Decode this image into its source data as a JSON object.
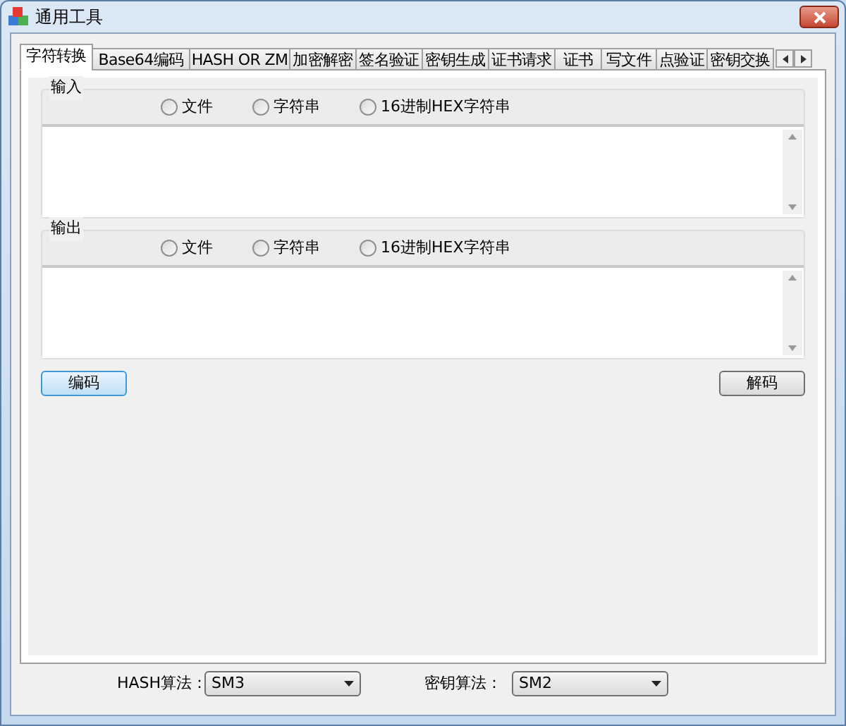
{
  "window": {
    "title": "通用工具"
  },
  "tabs": [
    {
      "label": "字符转换",
      "selected": true
    },
    {
      "label": "Base64编码",
      "selected": false
    },
    {
      "label": "HASH OR ZM",
      "selected": false
    },
    {
      "label": "加密解密",
      "selected": false
    },
    {
      "label": "签名验证",
      "selected": false
    },
    {
      "label": "密钥生成",
      "selected": false
    },
    {
      "label": "证书请求",
      "selected": false
    },
    {
      "label": "证书",
      "selected": false
    },
    {
      "label": "写文件",
      "selected": false
    },
    {
      "label": "点验证",
      "selected": false
    },
    {
      "label": "密钥交换",
      "selected": false
    }
  ],
  "groups": [
    {
      "title": "输入",
      "options": [
        {
          "label": "文件",
          "selected": false
        },
        {
          "label": "字符串",
          "selected": false
        },
        {
          "label": "16进制HEX字符串",
          "selected": false
        }
      ]
    },
    {
      "title": "输出",
      "options": [
        {
          "label": "文件",
          "selected": false
        },
        {
          "label": "字符串",
          "selected": false
        },
        {
          "label": "16进制HEX字符串",
          "selected": false
        }
      ]
    }
  ],
  "buttons": [
    {
      "label": "编码",
      "default": true
    },
    {
      "label": "解码",
      "default": false
    }
  ],
  "settings": [
    {
      "label": "HASH算法：",
      "value": "SM3"
    },
    {
      "label": "密钥算法：",
      "value": "SM2"
    }
  ]
}
